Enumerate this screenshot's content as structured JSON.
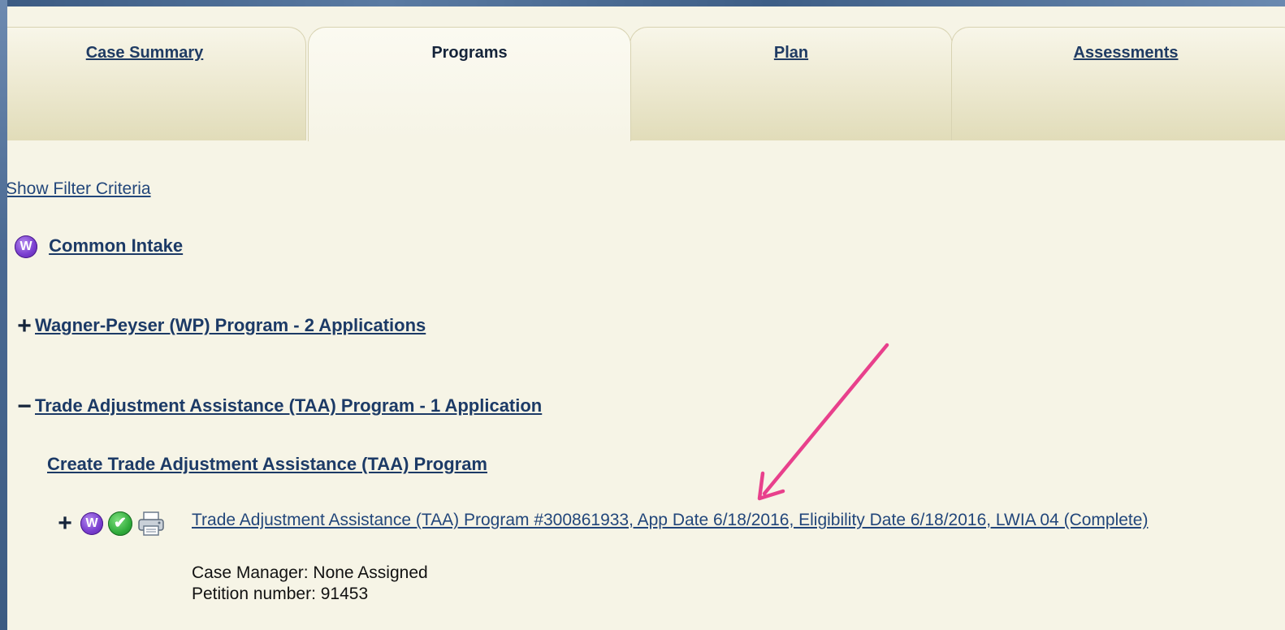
{
  "tabs": [
    {
      "label": "Case Summary",
      "active": false
    },
    {
      "label": "Programs",
      "active": true
    },
    {
      "label": "Plan",
      "active": false
    },
    {
      "label": "Assessments",
      "active": false
    }
  ],
  "filter_link": "Show Filter Criteria",
  "common_intake": {
    "icon_letter": "W",
    "label": "Common Intake"
  },
  "wagner_peyser": {
    "toggle": "+",
    "label": "Wagner-Peyser (WP) Program - 2 Applications"
  },
  "taa": {
    "toggle": "−",
    "label": "Trade Adjustment Assistance (TAA) Program - 1 Application",
    "create_link": "Create Trade Adjustment Assistance (TAA) Program",
    "application": {
      "toggle": "+",
      "icon_letter": "W",
      "check_glyph": "✔",
      "link_text": "Trade Adjustment Assistance (TAA) Program #300861933, App Date 6/18/2016, Eligibility Date 6/18/2016, LWIA 04 (Complete)",
      "case_manager": "Case Manager: None Assigned",
      "petition": "Petition number: 91453"
    }
  },
  "colors": {
    "page_bg": "#f6f4e6",
    "link": "#22467a",
    "annotation_arrow": "#e8408c",
    "frame": "#3f5f86"
  },
  "icons": [
    "w-badge-icon",
    "checkmark-icon",
    "printer-icon",
    "plus-icon",
    "minus-icon"
  ]
}
